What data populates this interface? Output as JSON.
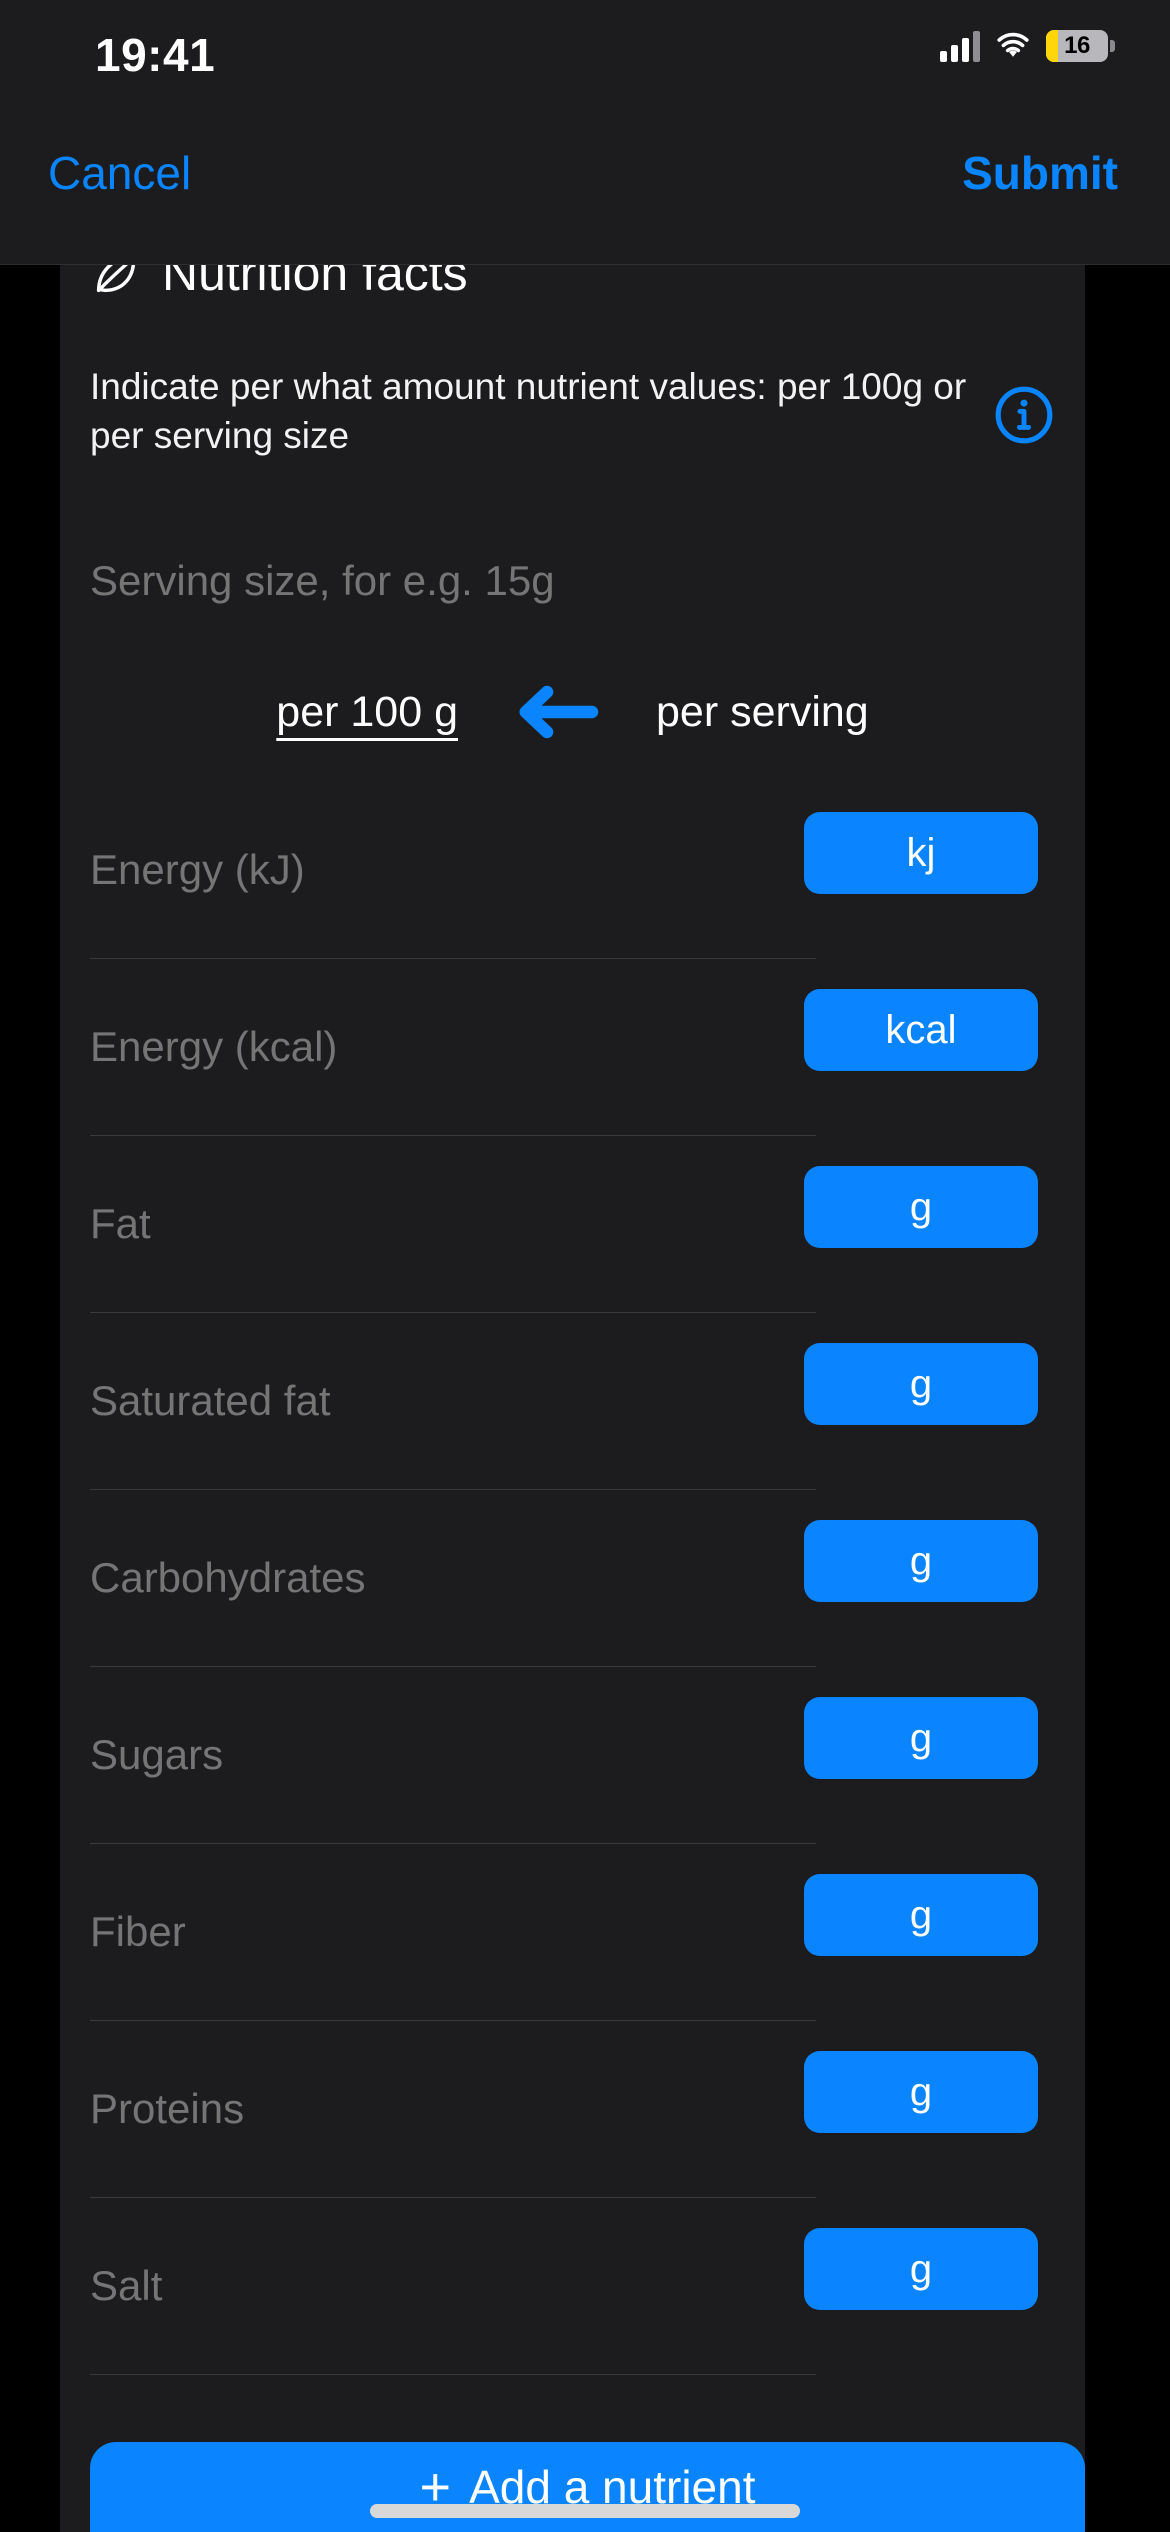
{
  "status_bar": {
    "time": "19:41",
    "battery_percent": "16",
    "icons": [
      "cellular-signal-icon",
      "wifi-icon",
      "battery-icon"
    ]
  },
  "nav_bar": {
    "cancel_label": "Cancel",
    "submit_label": "Submit"
  },
  "section": {
    "icon": "nutrition-leaf-icon",
    "title": "Nutrition facts",
    "description": "Indicate per what amount nutrient values: per 100g or per serving size",
    "info_icon": "info-circle-icon"
  },
  "serving_size": {
    "value": "",
    "placeholder": "Serving size, for e.g. 15g"
  },
  "per_toggle": {
    "per_100g_label": "per 100 g",
    "arrow_icon": "arrow-left-icon",
    "per_serving_label": "per serving",
    "selected": "per 100 g"
  },
  "nutrients": [
    {
      "label": "Energy (kJ)",
      "value": "",
      "unit": "kj"
    },
    {
      "label": "Energy (kcal)",
      "value": "",
      "unit": "kcal"
    },
    {
      "label": "Fat",
      "value": "",
      "unit": "g"
    },
    {
      "label": "Saturated fat",
      "value": "",
      "unit": "g"
    },
    {
      "label": "Carbohydrates",
      "value": "",
      "unit": "g"
    },
    {
      "label": "Sugars",
      "value": "",
      "unit": "g"
    },
    {
      "label": "Fiber",
      "value": "",
      "unit": "g"
    },
    {
      "label": "Proteins",
      "value": "",
      "unit": "g"
    },
    {
      "label": "Salt",
      "value": "",
      "unit": "g"
    }
  ],
  "add_nutrient": {
    "plus": "+",
    "label": "Add a nutrient"
  },
  "colors": {
    "accent": "#0a84ff",
    "card_background": "#1c1c1e",
    "page_background": "#000000",
    "label_text": "#8e8e93",
    "divider": "#3a3a3c",
    "battery_low": "#ffd60a"
  }
}
